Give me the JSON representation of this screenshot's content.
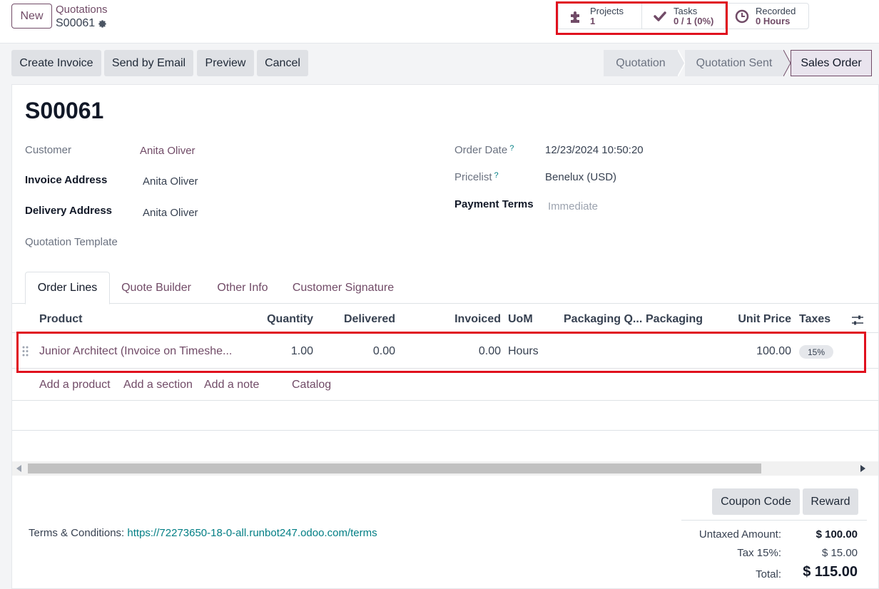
{
  "topbar": {
    "new_label": "New",
    "breadcrumb_parent": "Quotations",
    "breadcrumb_current": "S00061"
  },
  "smart_buttons": {
    "projects": {
      "label": "Projects",
      "value": "1"
    },
    "tasks": {
      "label": "Tasks",
      "value": "0 / 1 (0%)"
    },
    "recorded": {
      "label": "Recorded",
      "value": "0 Hours"
    }
  },
  "actions": {
    "create_invoice": "Create Invoice",
    "send_email": "Send by Email",
    "preview": "Preview",
    "cancel": "Cancel"
  },
  "status": {
    "stages": [
      "Quotation",
      "Quotation Sent",
      "Sales Order"
    ],
    "active": "Sales Order"
  },
  "record": {
    "name": "S00061",
    "customer_label": "Customer",
    "customer": "Anita Oliver",
    "invoice_address_label": "Invoice Address",
    "invoice_address": "Anita Oliver",
    "delivery_address_label": "Delivery Address",
    "delivery_address": "Anita Oliver",
    "quotation_template_label": "Quotation Template",
    "order_date_label": "Order Date",
    "order_date": "12/23/2024 10:50:20",
    "pricelist_label": "Pricelist",
    "pricelist": "Benelux (USD)",
    "payment_terms_label": "Payment Terms",
    "payment_terms_placeholder": "Immediate",
    "help_mark": "?"
  },
  "tabs": [
    "Order Lines",
    "Quote Builder",
    "Other Info",
    "Customer Signature"
  ],
  "table": {
    "headers": {
      "product": "Product",
      "quantity": "Quantity",
      "delivered": "Delivered",
      "invoiced": "Invoiced",
      "uom": "UoM",
      "packaging_qty": "Packaging Q...",
      "packaging": "Packaging",
      "unit_price": "Unit Price",
      "taxes": "Taxes"
    },
    "rows": [
      {
        "product": "Junior Architect (Invoice on Timeshe...",
        "quantity": "1.00",
        "delivered": "0.00",
        "invoiced": "0.00",
        "uom": "Hours",
        "unit_price": "100.00",
        "tax": "15%"
      }
    ],
    "add_links": [
      "Add a product",
      "Add a section",
      "Add a note",
      "Catalog"
    ]
  },
  "bottom": {
    "coupon_label": "Coupon Code",
    "reward_label": "Reward",
    "terms_label": "Terms & Conditions:",
    "terms_link": "https://72273650-18-0-all.runbot247.odoo.com/terms",
    "untaxed_label": "Untaxed Amount:",
    "untaxed_value": "$ 100.00",
    "tax_label": "Tax 15%:",
    "tax_value": "$ 15.00",
    "total_label": "Total:",
    "total_value": "$ 115.00"
  },
  "colors": {
    "brand": "#714b67",
    "link_teal": "#017e84",
    "highlight": "#e0101e"
  }
}
